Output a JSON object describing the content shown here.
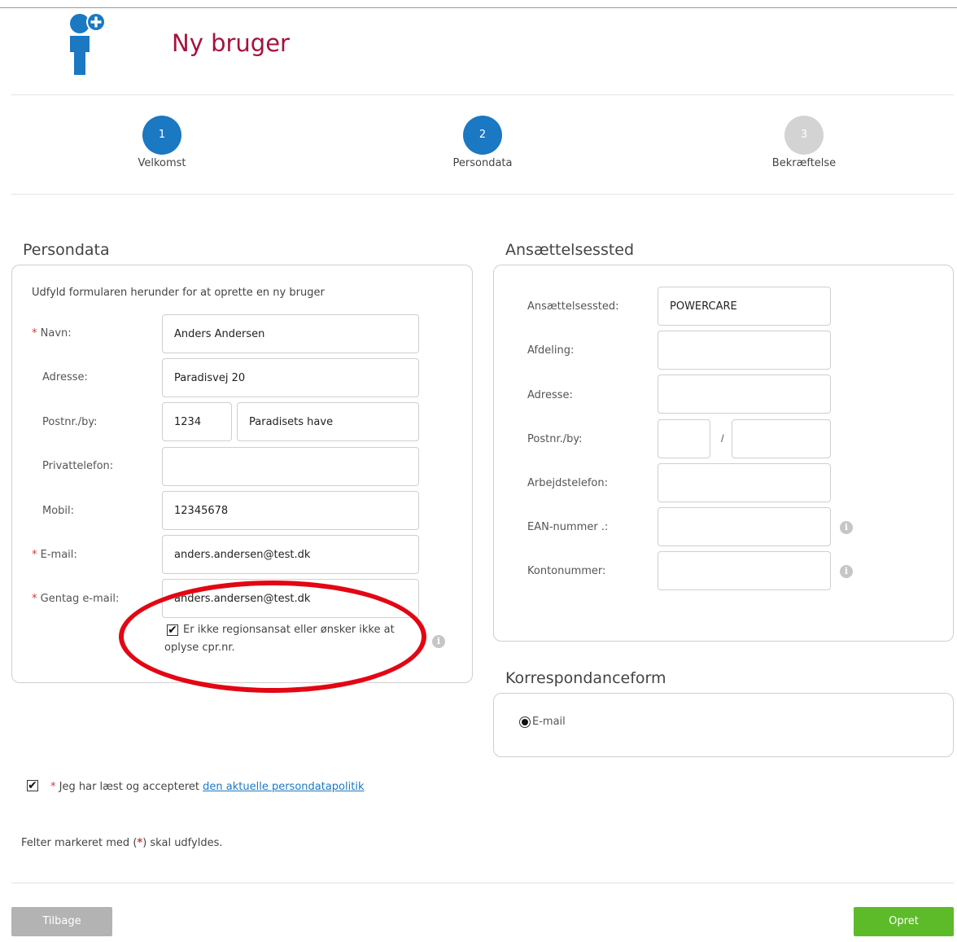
{
  "header": {
    "title": "Ny bruger"
  },
  "colors": {
    "brand_title": "#a6123c",
    "step_active": "#1b78c2",
    "step_inactive": "#d3d3d3",
    "required": "#d9363e",
    "primary_button": "#5dbb2a",
    "secondary_button": "#b3b3b3",
    "highlight_ring": "#e30613"
  },
  "steps": [
    {
      "number": "1",
      "label": "Velkomst",
      "state": "active"
    },
    {
      "number": "2",
      "label": "Persondata",
      "state": "active"
    },
    {
      "number": "3",
      "label": "Bekræftelse",
      "state": "inactive"
    }
  ],
  "persondata": {
    "title": "Persondata",
    "intro": "Udfyld formularen herunder for at oprette en ny bruger",
    "required_mark": "*",
    "fields": {
      "navn": {
        "label": "Navn:",
        "value": "Anders Andersen"
      },
      "adresse": {
        "label": "Adresse:",
        "value": "Paradisvej 20"
      },
      "postnr": {
        "label": "Postnr./by:",
        "postnr": "1234",
        "by": "Paradisets have"
      },
      "privattelefon": {
        "label": "Privattelefon:",
        "value": ""
      },
      "mobil": {
        "label": "Mobil:",
        "value": "12345678"
      },
      "email": {
        "label": "E-mail:",
        "value": "anders.andersen@test.dk"
      },
      "gentag_email": {
        "label": "Gentag e-mail:",
        "value": "anders.andersen@test.dk"
      }
    },
    "no_cpr_checkbox": {
      "checked": true,
      "label": "Er ikke regionsansat eller ønsker ikke at oplyse cpr.nr."
    }
  },
  "ansaettelse": {
    "title": "Ansættelsessted",
    "fields": {
      "sted": {
        "label": "Ansættelsessted:",
        "value": "POWERCARE"
      },
      "afdeling": {
        "label": "Afdeling:",
        "value": ""
      },
      "adresse": {
        "label": "Adresse:",
        "value": ""
      },
      "postnr": {
        "label": "Postnr./by:",
        "postnr": "",
        "by": "",
        "separator": "/"
      },
      "arbejdstelefon": {
        "label": "Arbejdstelefon:",
        "value": ""
      },
      "ean": {
        "label": "EAN-nummer .:",
        "value": ""
      },
      "konto": {
        "label": "Kontonummer:",
        "value": ""
      }
    }
  },
  "korrespondance": {
    "title": "Korrespondanceform",
    "option": {
      "label": "E-mail",
      "selected": true
    }
  },
  "consent": {
    "checked": true,
    "text": "Jeg har læst og accepteret ",
    "link": "den aktuelle persondatapolitik"
  },
  "footnote": {
    "before": "Felter markeret med (",
    "star": "*",
    "after": ") skal udfyldes."
  },
  "buttons": {
    "back": "Tilbage",
    "create": "Opret"
  },
  "icons": {
    "logo": "add-user-icon",
    "info": "info-icon",
    "check": "checkmark-icon"
  }
}
